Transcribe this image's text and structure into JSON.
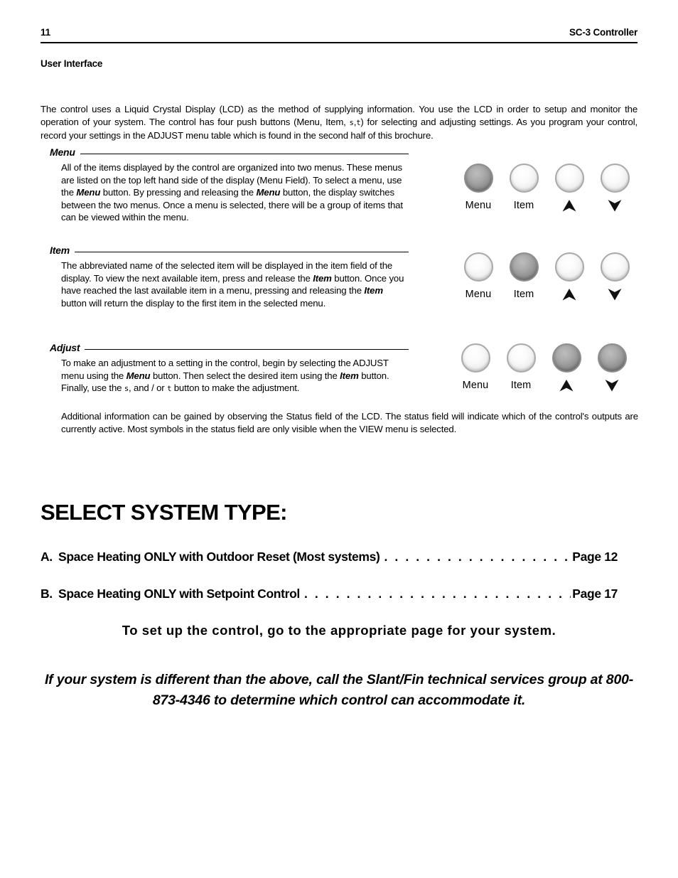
{
  "header": {
    "page_number": "11",
    "document_title": "SC-3 Controller"
  },
  "section_title": "User Interface",
  "intro_paragraph": {
    "part1": "The control uses a Liquid Crystal Display (LCD) as the method of supplying information. You use the LCD in order to setup and monitor the operation of your system. The control has four push buttons (Menu, Item, ",
    "symbol_up": "s",
    "symbol_sep": ",",
    "symbol_down": "t",
    "part2": ") for selecting and adjusting settings. As you program your control, record your settings in the ADJUST menu table which is found in the second half of this brochure."
  },
  "blocks": [
    {
      "id": "menu",
      "label": "Menu",
      "body_1": "All of the items displayed by the control are organized into two menus. These menus are listed on the top left hand side of the display (Menu Field). To select a menu, use the ",
      "bold_1": "Menu",
      "body_2": " button. By pressing and releasing the ",
      "bold_2": "Menu",
      "body_3": " button, the display switches between the two menus. Once a menu is selected, there will be a group of items that can be viewed within the menu."
    },
    {
      "id": "item",
      "label": "Item",
      "body_1": "The abbreviated name of the selected item will be displayed in the item field of the display. To view the next available item, press and release the ",
      "bold_1": "Item",
      "body_2": " button. Once you have reached the last available item in a menu, pressing and releasing the ",
      "bold_2": "Item",
      "body_3": " button will return the display to the first item in the selected menu."
    },
    {
      "id": "adjust",
      "label": "Adjust",
      "body_1": "To make an adjustment to a setting in the control, begin by selecting the ADJUST menu using the ",
      "bold_1": "Menu",
      "body_2": " button. Then select the desired item using the ",
      "bold_2": "Item",
      "body_3": " button. Finally, use the ",
      "symbol_up": "s",
      "body_4": ", and / or ",
      "symbol_down": "t",
      "body_5": " button to make the adjustment."
    }
  ],
  "trailing_note": "Additional information can be gained by observing the Status field of the LCD. The status field will indicate which of the control's outputs are currently active. Most symbols in the status field are only visible when the VIEW menu is selected.",
  "button_groups": [
    {
      "id": "menu",
      "buttons": [
        {
          "label": "Menu",
          "icon": "none",
          "state": "on"
        },
        {
          "label": "Item",
          "icon": "none",
          "state": "off"
        },
        {
          "label": "",
          "icon": "arrow-up",
          "state": "off"
        },
        {
          "label": "",
          "icon": "arrow-down",
          "state": "off"
        }
      ]
    },
    {
      "id": "item",
      "buttons": [
        {
          "label": "Menu",
          "icon": "none",
          "state": "off"
        },
        {
          "label": "Item",
          "icon": "none",
          "state": "on"
        },
        {
          "label": "",
          "icon": "arrow-up",
          "state": "off"
        },
        {
          "label": "",
          "icon": "arrow-down",
          "state": "off"
        }
      ]
    },
    {
      "id": "adjust",
      "buttons": [
        {
          "label": "Menu",
          "icon": "none",
          "state": "off"
        },
        {
          "label": "Item",
          "icon": "none",
          "state": "off"
        },
        {
          "label": "",
          "icon": "arrow-up",
          "state": "on"
        },
        {
          "label": "",
          "icon": "arrow-down",
          "state": "on"
        }
      ]
    }
  ],
  "big_heading": "SELECT SYSTEM TYPE:",
  "toc": [
    {
      "letter": "A.",
      "text": "Space Heating ONLY with Outdoor Reset (Most systems)",
      "dots": ". . . . . . . . . . . . . . . . . . . . . .",
      "page": "Page 12"
    },
    {
      "letter": "B.",
      "text": "Space Heating ONLY with Setpoint Control",
      "dots": ". . . . . . . . . . . . . . . . . . . . . . . . . . . . . . .",
      "page": "Page 17"
    }
  ],
  "callout_bold": "To set up the control, go to the appropriate page for your system.",
  "callout_italic": "If your system is different than the above, call the Slant/Fin technical services group at 800-873-4346 to determine which control can accommodate it."
}
